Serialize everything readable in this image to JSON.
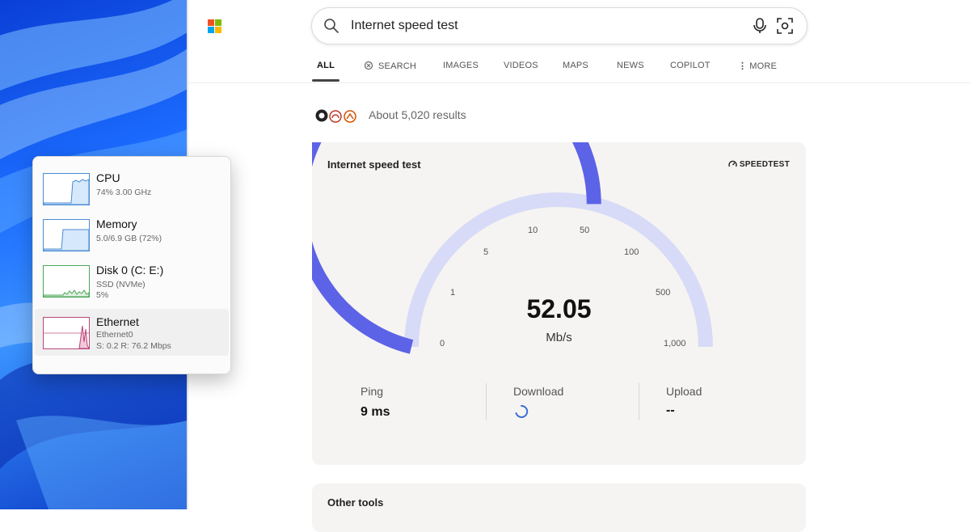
{
  "search": {
    "query": "Internet speed test"
  },
  "tabs": [
    "ALL",
    "SEARCH",
    "IMAGES",
    "VIDEOS",
    "MAPS",
    "NEWS",
    "COPILOT",
    "MORE"
  ],
  "results_count": "About 5,020 results",
  "speedtest": {
    "title": "Internet speed test",
    "provider": "SPEEDTEST",
    "value": "52.05",
    "unit": "Mb/s",
    "gauge_level": 52.05,
    "ticks": [
      "0",
      "1",
      "5",
      "10",
      "50",
      "100",
      "500",
      "1,000"
    ],
    "ping": {
      "label": "Ping",
      "value": "9 ms"
    },
    "download": {
      "label": "Download"
    },
    "upload": {
      "label": "Upload",
      "value": "--"
    },
    "colors": {
      "active_arc": "#5d63e6",
      "inactive_arc": "#d7dbf7"
    }
  },
  "other_tools": {
    "title": "Other tools"
  },
  "task_manager": {
    "items": [
      {
        "name": "CPU",
        "line1": "74% 3.00 GHz",
        "line2": ""
      },
      {
        "name": "Memory",
        "line1": "5.0/6.9 GB (72%)",
        "line2": ""
      },
      {
        "name": "Disk 0 (C: E:)",
        "line1": "SSD (NVMe)",
        "line2": "5%"
      },
      {
        "name": "Ethernet",
        "line1": "Ethernet0",
        "line2": "S: 0.2 R: 76.2 Mbps"
      }
    ]
  }
}
